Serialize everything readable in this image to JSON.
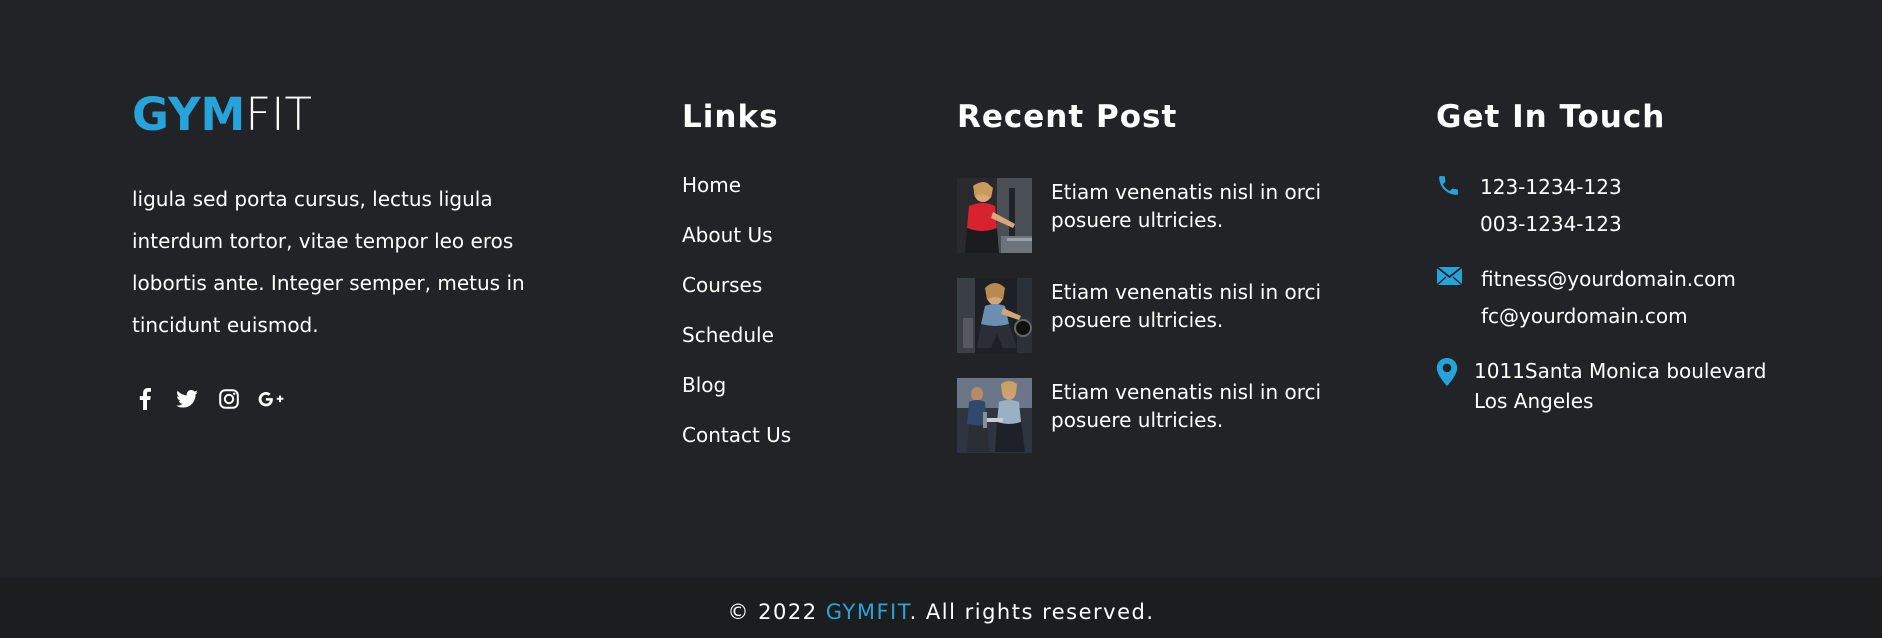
{
  "brand": {
    "logo_part1": "GYM",
    "logo_part2": "FIT",
    "accent_color": "#27a3dc",
    "description": "ligula sed porta cursus, lectus ligula interdum tortor, vitae tempor leo eros lobortis ante. Integer semper, metus in tincidunt euismod.",
    "social": [
      "facebook-icon",
      "twitter-icon",
      "instagram-icon",
      "google-plus-icon"
    ]
  },
  "links": {
    "heading": "Links",
    "items": [
      "Home",
      "About Us",
      "Courses",
      "Schedule",
      "Blog",
      "Contact Us"
    ]
  },
  "recent_posts": {
    "heading": "Recent Post",
    "items": [
      {
        "title": "Etiam venenatis nisl in orci posuere ultricies."
      },
      {
        "title": "Etiam venenatis nisl in orci posuere ultricies."
      },
      {
        "title": "Etiam venenatis nisl in orci posuere ultricies."
      }
    ]
  },
  "contact": {
    "heading": "Get In Touch",
    "phones": [
      "123-1234-123",
      "003-1234-123"
    ],
    "emails": [
      "fitness@yourdomain.com",
      "fc@yourdomain.com"
    ],
    "address": [
      "1011Santa Monica boulevard",
      "Los Angeles"
    ]
  },
  "footer": {
    "copyright_prefix": "© 2022 ",
    "copyright_brand": "GYMFIT",
    "copyright_suffix": ". All rights reserved."
  },
  "colors": {
    "background": "#222326",
    "bottom_bar": "#1c1d1f",
    "accent": "#27a3dc",
    "text": "#ffffff"
  }
}
